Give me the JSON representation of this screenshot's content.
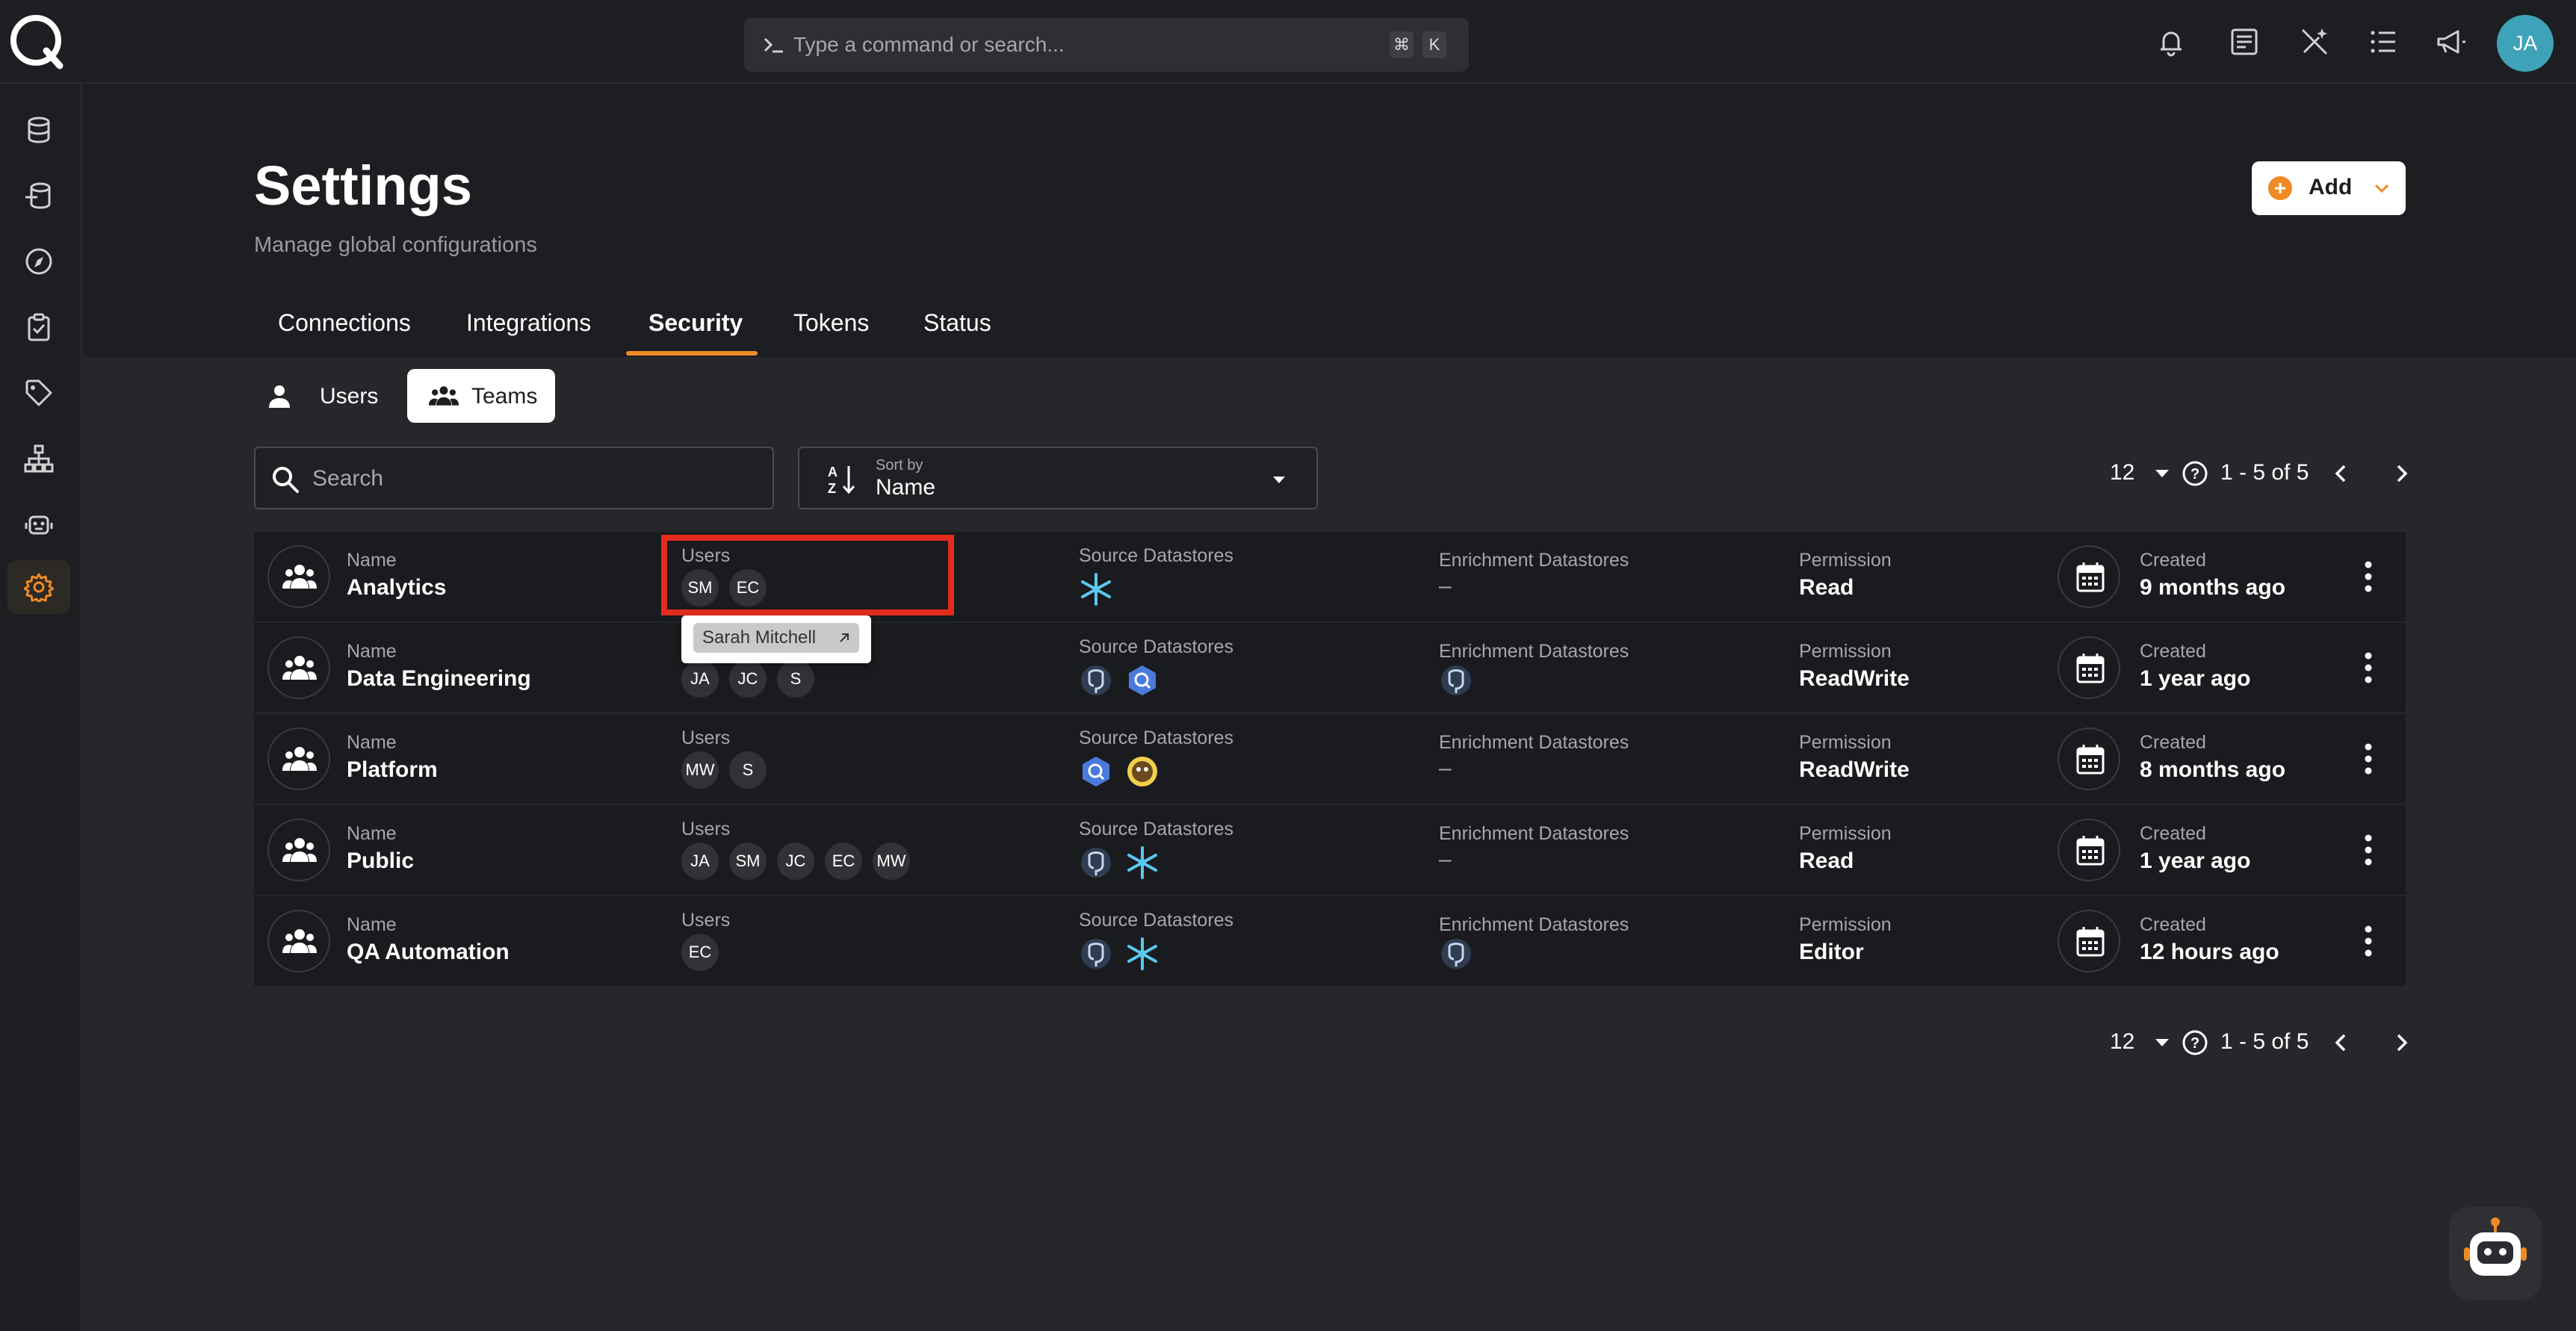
{
  "command_bar": {
    "placeholder": "Type a command or search...",
    "shortcut_mod": "⌘",
    "shortcut_key": "K"
  },
  "user_avatar": "JA",
  "page": {
    "title": "Settings",
    "subtitle": "Manage global configurations",
    "add_label": "Add"
  },
  "tabs": [
    {
      "label": "Connections"
    },
    {
      "label": "Integrations"
    },
    {
      "label": "Security",
      "active": true
    },
    {
      "label": "Tokens"
    },
    {
      "label": "Status"
    }
  ],
  "subtabs": {
    "users": "Users",
    "teams": "Teams"
  },
  "search": {
    "placeholder": "Search"
  },
  "sort": {
    "caption": "Sort by",
    "value": "Name"
  },
  "pager": {
    "per_page": "12",
    "range": "1 - 5 of 5"
  },
  "columns": {
    "name": "Name",
    "users": "Users",
    "source": "Source Datastores",
    "enrichment": "Enrichment Datastores",
    "permission": "Permission",
    "created": "Created"
  },
  "teams": [
    {
      "name": "Analytics",
      "users": [
        "SM",
        "EC"
      ],
      "source": [
        "snowflake"
      ],
      "enrichment": [],
      "enrichment_empty": "–",
      "permission": "Read",
      "created": "9 months ago"
    },
    {
      "name": "Data Engineering",
      "users": [
        "JA",
        "JC",
        "S"
      ],
      "source": [
        "postgres",
        "bigquery"
      ],
      "enrichment": [
        "postgres"
      ],
      "enrichment_empty": "",
      "permission": "ReadWrite",
      "created": "1 year ago"
    },
    {
      "name": "Platform",
      "users": [
        "MW",
        "S"
      ],
      "source": [
        "bigquery",
        "hive"
      ],
      "enrichment": [],
      "enrichment_empty": "–",
      "permission": "ReadWrite",
      "created": "8 months ago"
    },
    {
      "name": "Public",
      "users": [
        "JA",
        "SM",
        "JC",
        "EC",
        "MW"
      ],
      "source": [
        "postgres",
        "snowflake"
      ],
      "enrichment": [],
      "enrichment_empty": "–",
      "permission": "Read",
      "created": "1 year ago"
    },
    {
      "name": "QA Automation",
      "users": [
        "EC"
      ],
      "source": [
        "postgres",
        "snowflake"
      ],
      "enrichment": [
        "postgres"
      ],
      "enrichment_empty": "",
      "permission": "Editor",
      "created": "12 hours ago"
    }
  ],
  "tooltip": {
    "name": "Sarah Mitchell"
  },
  "colors": {
    "accent": "#f08a24",
    "highlight": "#e32b1e",
    "avatar": "#3ea3b8"
  }
}
